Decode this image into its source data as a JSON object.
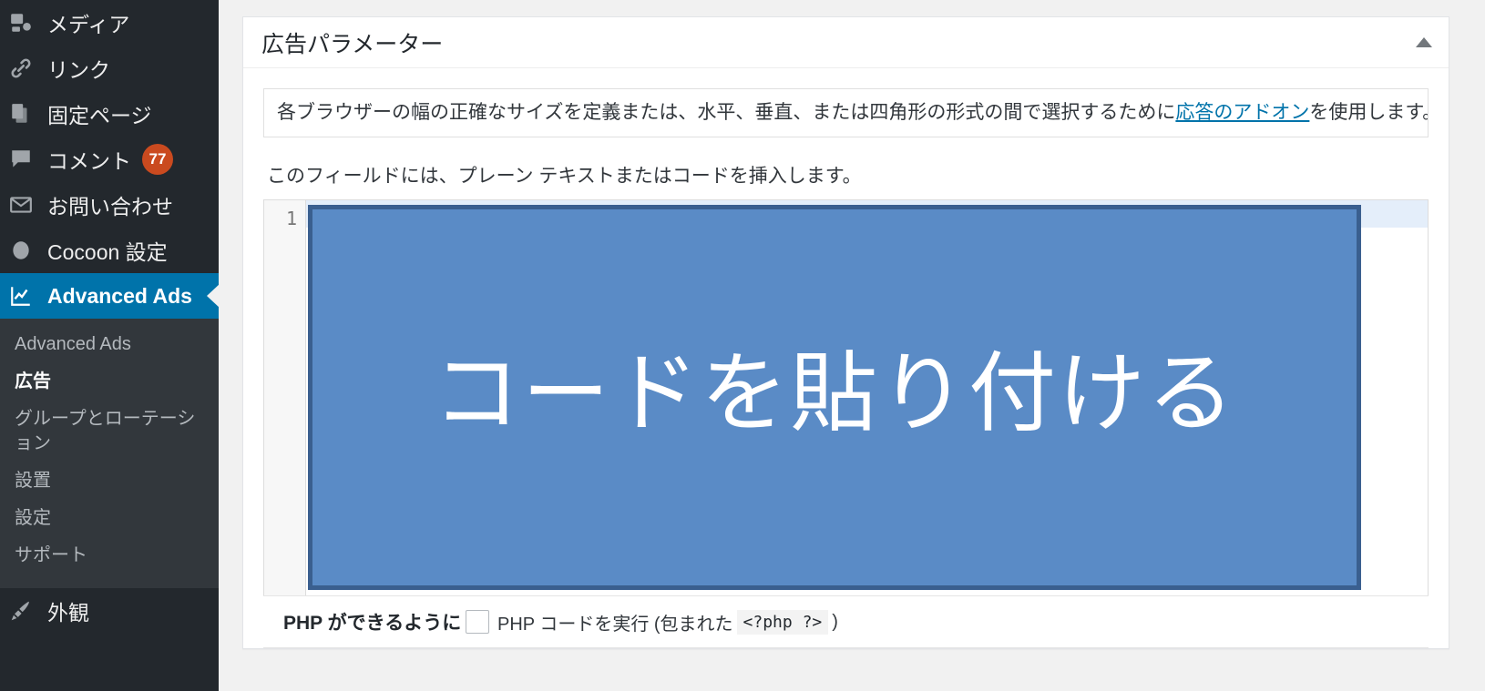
{
  "sidebar": {
    "items": [
      {
        "label": "メディア",
        "icon": "media-icon",
        "badge": null,
        "active": false
      },
      {
        "label": "リンク",
        "icon": "link-icon",
        "badge": null,
        "active": false
      },
      {
        "label": "固定ページ",
        "icon": "pages-icon",
        "badge": null,
        "active": false
      },
      {
        "label": "コメント",
        "icon": "comment-icon",
        "badge": "77",
        "active": false
      },
      {
        "label": "お問い合わせ",
        "icon": "envelope-icon",
        "badge": null,
        "active": false
      },
      {
        "label": "Cocoon 設定",
        "icon": "circle-icon",
        "badge": null,
        "active": false
      },
      {
        "label": "Advanced Ads",
        "icon": "chart-icon",
        "badge": null,
        "active": true
      }
    ],
    "submenu": [
      {
        "label": "Advanced Ads",
        "current": false
      },
      {
        "label": "広告",
        "current": true
      },
      {
        "label": "グループとローテーション",
        "current": false
      },
      {
        "label": "設置",
        "current": false
      },
      {
        "label": "設定",
        "current": false
      },
      {
        "label": "サポート",
        "current": false
      }
    ],
    "after_submenu": [
      {
        "label": "外観",
        "icon": "appearance-icon",
        "badge": null,
        "active": false
      }
    ],
    "active_color": "#0073aa",
    "badge_color": "#ca4a1f",
    "bg_color": "#23282d",
    "submenu_bg_color": "#32373c"
  },
  "panel": {
    "title": "広告パラメーター",
    "toggle_icon": "chevron-up-icon",
    "notice": {
      "before": "各ブラウザーの幅の正確なサイズを定義または、水平、垂直、または四角形の形式の間で選択するために",
      "link": "応答のアドオン",
      "after": "を使用します。"
    },
    "field_description": "このフィールドには、プレーン テキストまたはコードを挿入します。",
    "editor": {
      "line_number": "1",
      "content": "",
      "overlay_text": "コードを貼り付ける",
      "overlay_fill": "#5a8bc6",
      "overlay_border": "#3a5f8f",
      "active_line_color": "#e4eefa"
    },
    "php_row": {
      "label": "PHP ができるように",
      "checkbox_checked": false,
      "text_before": "PHP コードを実行 (包まれた",
      "code": "<?php ?>",
      "text_after": ")"
    }
  }
}
